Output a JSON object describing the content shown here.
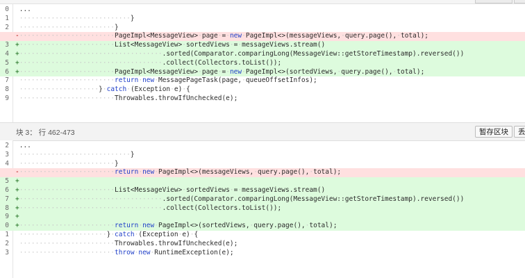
{
  "hunk2": {
    "lines": [
      {
        "num": "0",
        "type": "ctx",
        "sign": "",
        "indent": 0,
        "text": "..."
      },
      {
        "num": "1",
        "type": "ctx",
        "sign": "",
        "indent": 28,
        "text": "}"
      },
      {
        "num": "2",
        "type": "ctx",
        "sign": "",
        "indent": 24,
        "text": "}"
      },
      {
        "num": "",
        "type": "del",
        "sign": "-",
        "indent": 24,
        "text": "PageImpl<MessageView> page = new PageImpl<>(messageViews, query.page(), total);"
      },
      {
        "num": "3",
        "type": "add",
        "sign": "+",
        "indent": 24,
        "text": "List<MessageView> sortedViews = messageViews.stream()"
      },
      {
        "num": "4",
        "type": "add",
        "sign": "+",
        "indent": 36,
        "text": ".sorted(Comparator.comparingLong(MessageView::getStoreTimestamp).reversed())"
      },
      {
        "num": "5",
        "type": "add",
        "sign": "+",
        "indent": 36,
        "text": ".collect(Collectors.toList());"
      },
      {
        "num": "6",
        "type": "add",
        "sign": "+",
        "indent": 24,
        "text": "PageImpl<MessageView> page = new PageImpl<>(sortedViews, query.page(), total);"
      },
      {
        "num": "7",
        "type": "ctx",
        "sign": "",
        "indent": 24,
        "text": "return new MessagePageTask(page, queueOffsetInfos);"
      },
      {
        "num": "8",
        "type": "ctx",
        "sign": "",
        "indent": 20,
        "text": "} catch (Exception e) {"
      },
      {
        "num": "9",
        "type": "ctx",
        "sign": "",
        "indent": 24,
        "text": "Throwables.throwIfUnchecked(e);"
      }
    ]
  },
  "hunk3": {
    "header": "块 3： 行 462-473",
    "stage_button": "暂存区块",
    "discard_button": "丢",
    "lines": [
      {
        "num": "2",
        "type": "ctx",
        "sign": "",
        "indent": 0,
        "text": "..."
      },
      {
        "num": "3",
        "type": "ctx",
        "sign": "",
        "indent": 28,
        "text": "}"
      },
      {
        "num": "4",
        "type": "ctx",
        "sign": "",
        "indent": 24,
        "text": "}"
      },
      {
        "num": "",
        "type": "del",
        "sign": "-",
        "indent": 24,
        "text": "return new PageImpl<>(messageViews, query.page(), total);"
      },
      {
        "num": "5",
        "type": "add",
        "sign": "+",
        "indent": 0,
        "text": ""
      },
      {
        "num": "6",
        "type": "add",
        "sign": "+",
        "indent": 24,
        "text": "List<MessageView> sortedViews = messageViews.stream()"
      },
      {
        "num": "7",
        "type": "add",
        "sign": "+",
        "indent": 36,
        "text": ".sorted(Comparator.comparingLong(MessageView::getStoreTimestamp).reversed())"
      },
      {
        "num": "8",
        "type": "add",
        "sign": "+",
        "indent": 36,
        "text": ".collect(Collectors.toList());"
      },
      {
        "num": "9",
        "type": "add",
        "sign": "+",
        "indent": 0,
        "text": ""
      },
      {
        "num": "0",
        "type": "add",
        "sign": "+",
        "indent": 24,
        "text": "return new PageImpl<>(sortedViews, query.page(), total);"
      },
      {
        "num": "1",
        "type": "ctx",
        "sign": "",
        "indent": 22,
        "text": "} catch (Exception e) {"
      },
      {
        "num": "2",
        "type": "ctx",
        "sign": "",
        "indent": 24,
        "text": "Throwables.throwIfUnchecked(e);"
      },
      {
        "num": "3",
        "type": "ctx",
        "sign": "",
        "indent": 24,
        "text": "throw new RuntimeException(e);"
      }
    ]
  }
}
